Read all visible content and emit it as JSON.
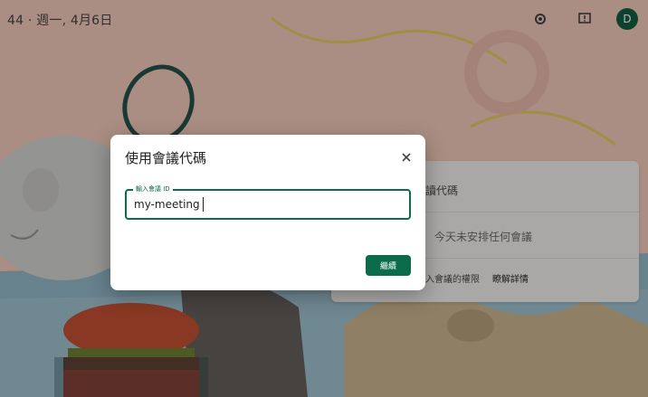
{
  "topbar": {
    "clock_text": "44 · 週一, 4月6日",
    "icons": [
      "settings-gear-icon",
      "feedback-icon"
    ],
    "avatar_letter": "D"
  },
  "side_panel": {
    "row1_text": "讀代碼",
    "row2_text": "今天未安排任何會議",
    "row3_text": "入會議的權限",
    "row3_link": "瞭解詳情"
  },
  "dialog": {
    "title": "使用會議代碼",
    "field_label": "輸入會議 ID",
    "field_value": "my-meeting",
    "continue_label": "繼續",
    "close_icon": "close-icon"
  },
  "colors": {
    "accent": "#0b6b4a",
    "avatar_bg": "#0b5a3c",
    "overlay": "rgba(20,20,20,0.32)"
  }
}
